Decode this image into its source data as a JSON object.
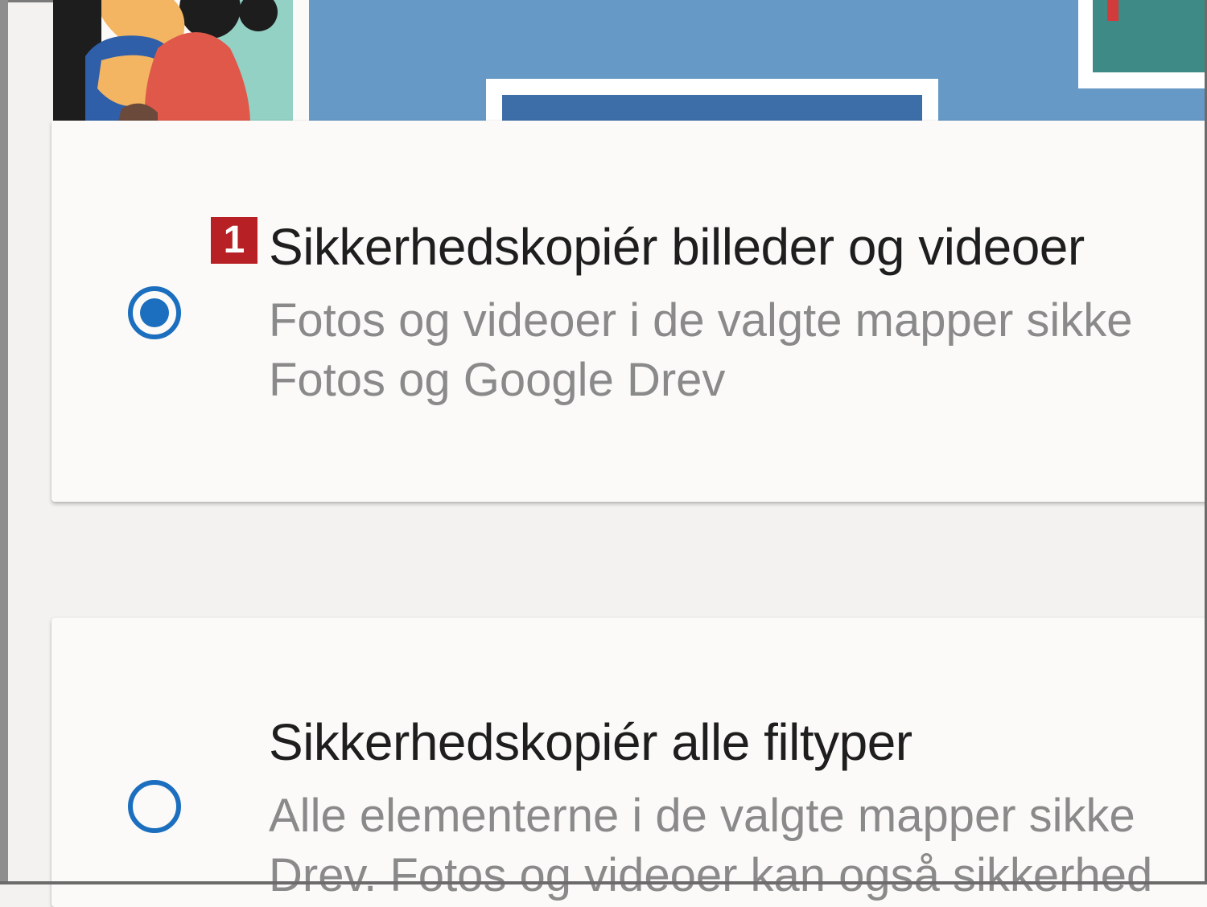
{
  "options": [
    {
      "badge": "1",
      "title": "Sikkerhedskopiér billeder og videoer",
      "desc_line1": "Fotos og videoer i de valgte mapper sikke",
      "desc_line2": "Fotos og Google Drev",
      "selected": true
    },
    {
      "title": "Sikkerhedskopiér alle filtyper",
      "desc_line1": "Alle elementerne i de valgte mapper sikke",
      "desc_line2": "Drev. Fotos og videoer kan også sikkerhed",
      "selected": false
    }
  ],
  "colors": {
    "accent": "#1b6fbe",
    "badge": "#b72025",
    "title_text": "#1e1e1e",
    "desc_text": "#8a8a8a",
    "banner_blue": "#6699c6"
  }
}
